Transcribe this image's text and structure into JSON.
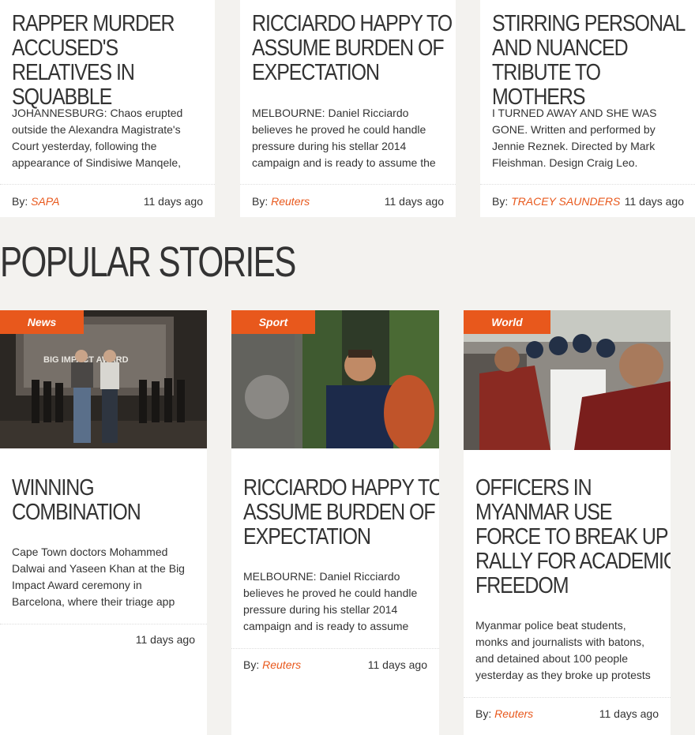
{
  "top_articles": [
    {
      "title": "RAPPER MURDER ACCUSED'S RELATIVES IN SQUABBLE",
      "excerpt": "JOHANNESBURG: Chaos erupted outside the Alexandra Magistrate's Court yesterday, following the appearance of Sindisiwe Manqele,",
      "by": "By:",
      "author": "SAPA",
      "time": "11 days ago"
    },
    {
      "title": "RICCIARDO HAPPY TO ASSUME BURDEN OF EXPECTATION",
      "excerpt": "MELBOURNE: Daniel Ricciardo believes he proved he could handle pressure during his stellar 2014 campaign and is ready to assume the",
      "by": "By:",
      "author": "Reuters",
      "time": "11 days ago"
    },
    {
      "title": "STIRRING PERSONAL AND NUANCED TRIBUTE TO MOTHERS",
      "excerpt": "I TURNED AWAY AND SHE WAS GONE. Written and performed by Jennie Reznek. Directed by Mark Fleishman. Design Craig Leo.",
      "by": "By:",
      "author": "TRACEY SAUNDERS",
      "time": "11 days ago"
    }
  ],
  "popular": {
    "heading": "POPULAR STORIES",
    "items": [
      {
        "tag": "News",
        "image": "award-ceremony-photo",
        "title": "WINNING COMBINATION",
        "excerpt": "Cape Town doctors Mohammed Dalwai and Yaseen Khan at the Big Impact Award ceremony in Barcelona, where their triage app",
        "time": "11 days ago"
      },
      {
        "tag": "Sport",
        "image": "ricciardo-interview-photo",
        "title": "RICCIARDO HAPPY TO ASSUME BURDEN OF EXPECTATION",
        "excerpt": "MELBOURNE: Daniel Ricciardo believes he proved he could handle pressure during his stellar 2014 campaign and is ready to assume",
        "by": "By:",
        "author": "Reuters",
        "time": "11 days ago"
      },
      {
        "tag": "World",
        "image": "myanmar-rally-photo",
        "title": "OFFICERS IN MYANMAR USE FORCE TO BREAK UP RALLY FOR ACADEMIC FREEDOM",
        "excerpt": "Myanmar police beat students, monks and journalists with batons, and detained about 100 people yesterday as they broke up protests",
        "by": "By:",
        "author": "Reuters",
        "time": "11 days ago"
      }
    ]
  },
  "colors": {
    "accent": "#e8581c",
    "text": "#333333",
    "background": "#f3f2ef"
  }
}
